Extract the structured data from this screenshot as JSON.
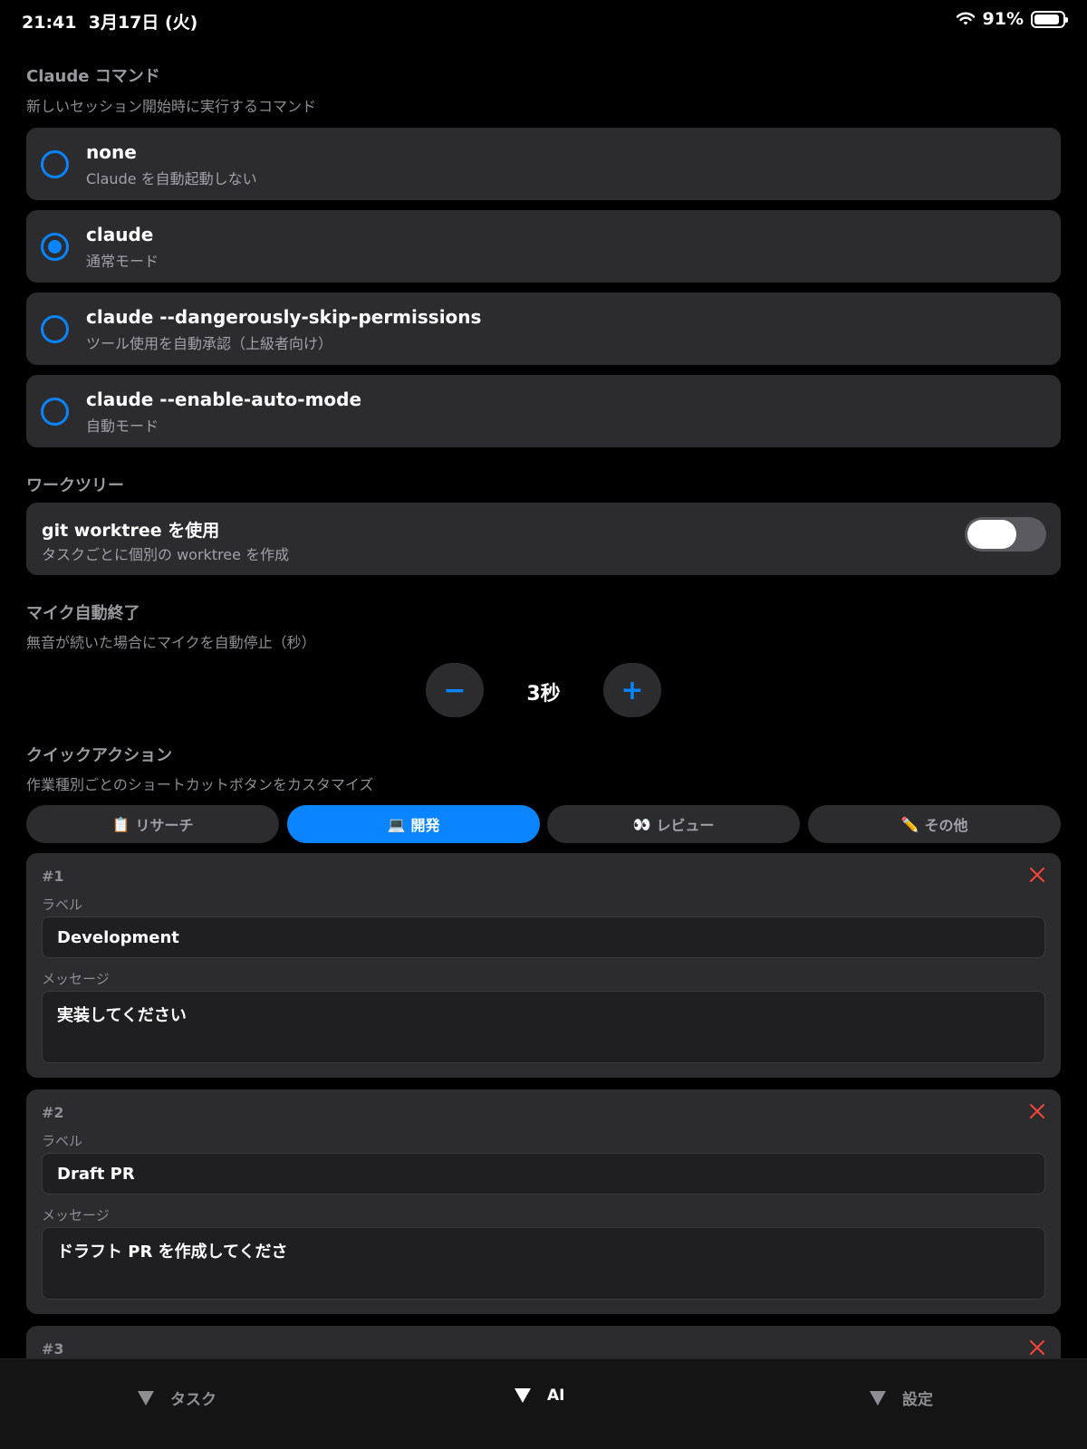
{
  "status": {
    "time": "21:41",
    "date": "3月17日 (火)",
    "battery": "91%"
  },
  "claude_command": {
    "title": "Claude コマンド",
    "subtitle": "新しいセッション開始時に実行するコマンド",
    "options": [
      {
        "title": "none",
        "sub": "Claude を自動起動しない",
        "selected": false
      },
      {
        "title": "claude",
        "sub": "通常モード",
        "selected": true
      },
      {
        "title": "claude --dangerously-skip-permissions",
        "sub": "ツール使用を自動承認（上級者向け）",
        "selected": false
      },
      {
        "title": "claude --enable-auto-mode",
        "sub": "自動モード",
        "selected": false
      }
    ]
  },
  "worktree": {
    "title": "ワークツリー",
    "label": "git worktree を使用",
    "sub": "タスクごとに個別の worktree を作成",
    "enabled": false
  },
  "mic": {
    "title": "マイク自動終了",
    "subtitle": "無音が続いた場合にマイクを自動停止（秒）",
    "minus": "−",
    "plus": "+",
    "value": "3秒"
  },
  "quick_actions": {
    "title": "クイックアクション",
    "subtitle": "作業種別ごとのショートカットボタンをカスタマイズ",
    "tabs": [
      {
        "icon": "📋",
        "label": "リサーチ",
        "active": false
      },
      {
        "icon": "💻",
        "label": "開発",
        "active": true
      },
      {
        "icon": "👀",
        "label": "レビュー",
        "active": false
      },
      {
        "icon": "✏️",
        "label": "その他",
        "active": false
      }
    ],
    "label_caption": "ラベル",
    "message_caption": "メッセージ",
    "items": [
      {
        "num": "#1",
        "label": "Development",
        "message": "実装してください"
      },
      {
        "num": "#2",
        "label": "Draft PR",
        "message": "ドラフト PR を作成してくださ"
      },
      {
        "num": "#3"
      }
    ]
  },
  "tabbar": [
    {
      "label": "タスク",
      "active": false
    },
    {
      "label": "AI",
      "active": true
    },
    {
      "label": "設定",
      "active": false
    }
  ],
  "colors": {
    "accent": "#0a84ff",
    "card": "#2c2c2e",
    "danger": "#ff453a"
  }
}
